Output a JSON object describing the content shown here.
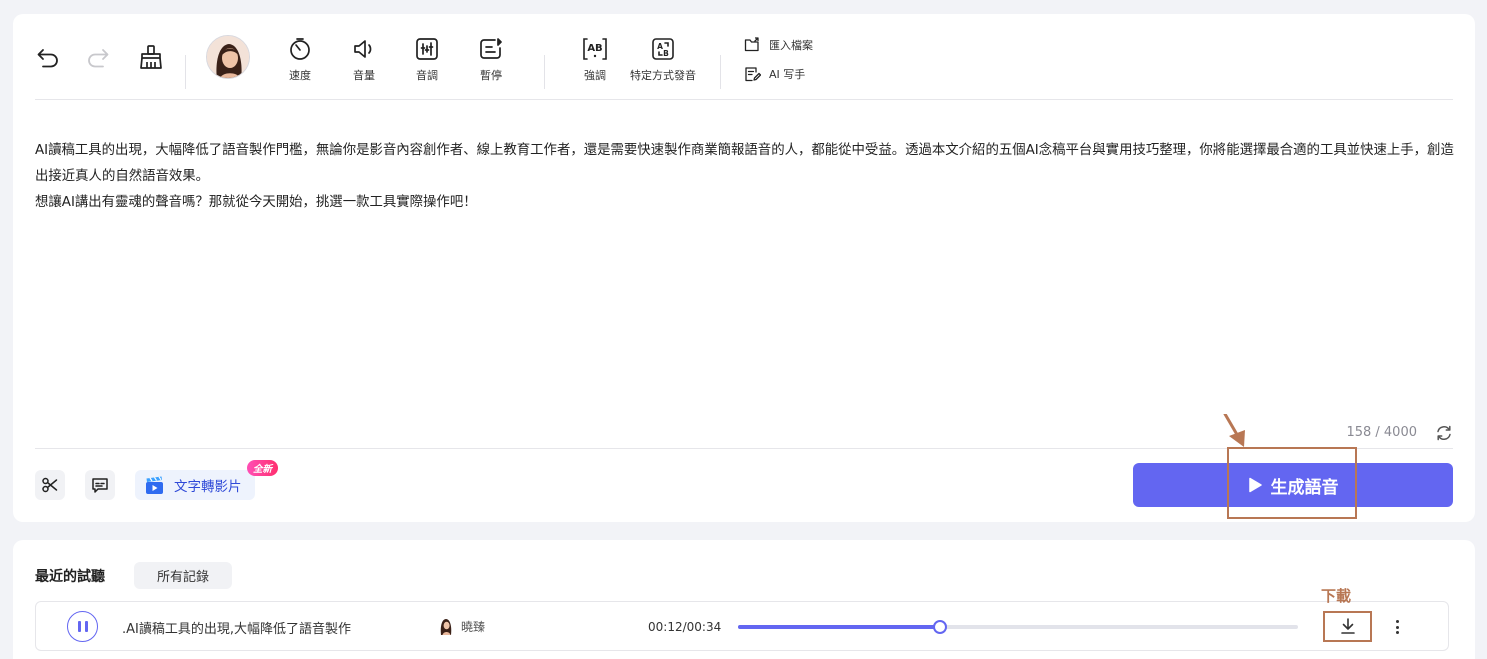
{
  "toolbar": {
    "speed_label": "速度",
    "volume_label": "音量",
    "pitch_label": "音調",
    "pause_label": "暫停",
    "emphasis_label": "強調",
    "pronunciation_label": "特定方式發音",
    "import_label": "匯入檔案",
    "ai_writer_label": "AI 写手"
  },
  "editor": {
    "paragraphs": [
      "AI讀稿工具的出現，大幅降低了語音製作門檻，無論你是影音內容創作者、線上教育工作者，還是需要快速製作商業簡報語音的人，都能從中受益。透過本文介紹的五個AI念稿平台與實用技巧整理，你將能選擇最合適的工具並快速上手，創造出接近真人的自然語音效果。",
      "想讓AI講出有靈魂的聲音嗎？那就從今天開始，挑選一款工具實際操作吧！"
    ],
    "char_count": "158 / 4000"
  },
  "bottom_bar": {
    "text_to_video_label": "文字轉影片",
    "new_badge": "全新",
    "generate_label": "生成語音"
  },
  "annotation": {
    "download_label": "下載"
  },
  "history": {
    "title": "最近的試聽",
    "tab_all": "所有記錄",
    "items": [
      {
        "title": ".AI讀稿工具的出現,大幅降低了語音製作",
        "voice": "曉臻",
        "time": "00:12/00:34",
        "progress": 0.36
      }
    ]
  },
  "colors": {
    "accent": "#6366f1",
    "annotation": "#b87754",
    "badge": "#ff2f6e"
  }
}
